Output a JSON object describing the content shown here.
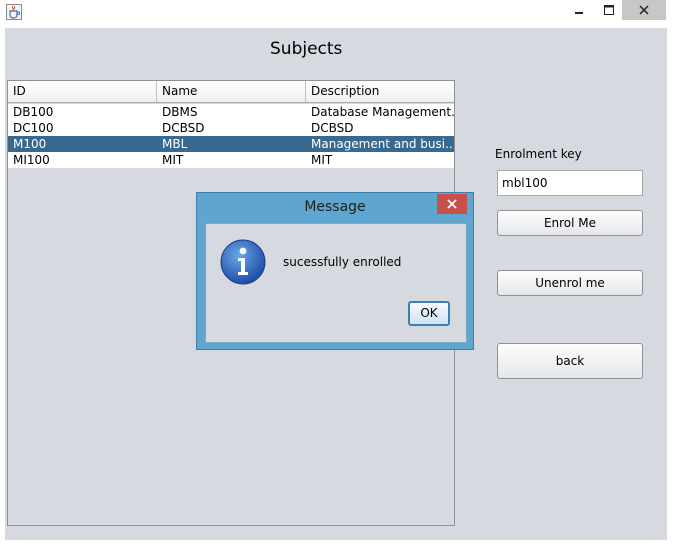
{
  "window": {
    "app_icon": "java-coffee-cup-icon",
    "controls": [
      "minimize-icon",
      "maximize-icon",
      "close-icon"
    ]
  },
  "main": {
    "heading": "Subjects",
    "table": {
      "columns": [
        "ID",
        "Name",
        "Description"
      ],
      "rows": [
        {
          "id": "DB100",
          "name": "DBMS",
          "description": "Database Management...",
          "selected": false
        },
        {
          "id": "DC100",
          "name": "DCBSD",
          "description": "DCBSD",
          "selected": false
        },
        {
          "id": "M100",
          "name": "MBL",
          "description": "Management and busi...",
          "selected": true
        },
        {
          "id": "MI100",
          "name": "MIT",
          "description": "MIT",
          "selected": false
        }
      ]
    },
    "enrolment_key_label": "Enrolment key",
    "enrolment_key_value": "mbl100",
    "enrol_button": "Enrol Me",
    "unenrol_button": "Unenrol me",
    "back_button": "back"
  },
  "dialog": {
    "title": "Message",
    "icon": "information-icon",
    "message": "sucessfully enrolled",
    "ok_button": "OK"
  },
  "colors": {
    "selection": "#39698f",
    "dialog_frame": "#5ea6cf",
    "panel": "#d6d9df",
    "close_red": "#c7504a"
  }
}
